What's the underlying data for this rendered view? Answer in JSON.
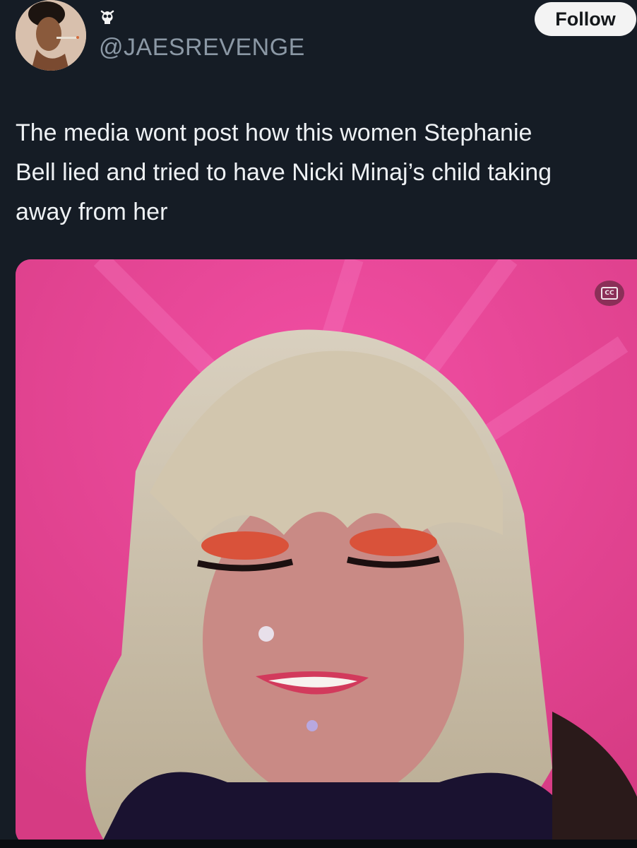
{
  "tweet": {
    "handle": "@JAESREVENGE",
    "follow_label": "Follow",
    "text": "The media wont post how this women Stephanie\nBell lied and tried to have Nicki Minaj’s child taking\naway from her",
    "avatar_icon": "profile-photo",
    "badge_icon": "skull-emoji-icon",
    "media": {
      "caption_button_label": "CC",
      "caption_icon": "closed-captions-icon"
    }
  },
  "colors": {
    "background": "#151c25",
    "text": "#eef1f4",
    "handle": "#8b98a5",
    "follow_bg": "#f3f3f3",
    "media_background": "#e0408e"
  }
}
